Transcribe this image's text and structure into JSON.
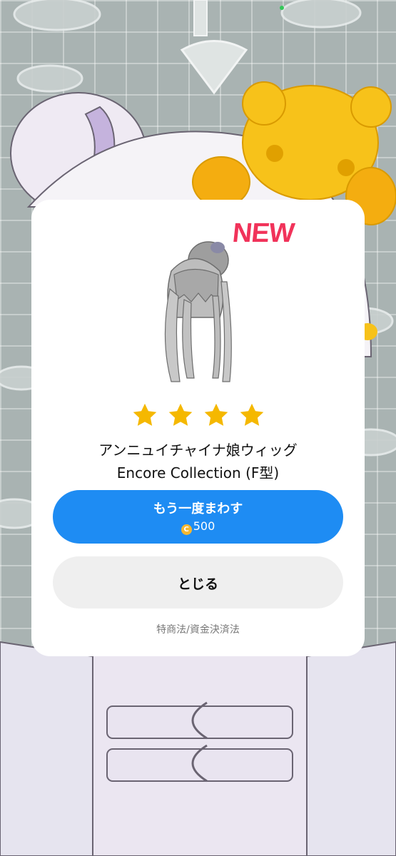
{
  "dialog": {
    "badge": "NEW",
    "rating_stars": 4,
    "item_name": "アンニュイチャイナ娘ウィッグ",
    "item_collection": "Encore Collection (F型)",
    "spin_again": {
      "label": "もう一度まわす",
      "coin_symbol": "C",
      "cost": "500"
    },
    "close_label": "とじる",
    "legal_link": "特商法/資金決済法"
  },
  "colors": {
    "primary_button": "#1e8cf3",
    "secondary_button": "#efefef",
    "new_badge": "#f1335a",
    "star": "#f5b800",
    "coin": "#f4b730"
  },
  "icons": {
    "star": "star-icon",
    "coin": "coin-icon",
    "item": "wig-item-image"
  }
}
